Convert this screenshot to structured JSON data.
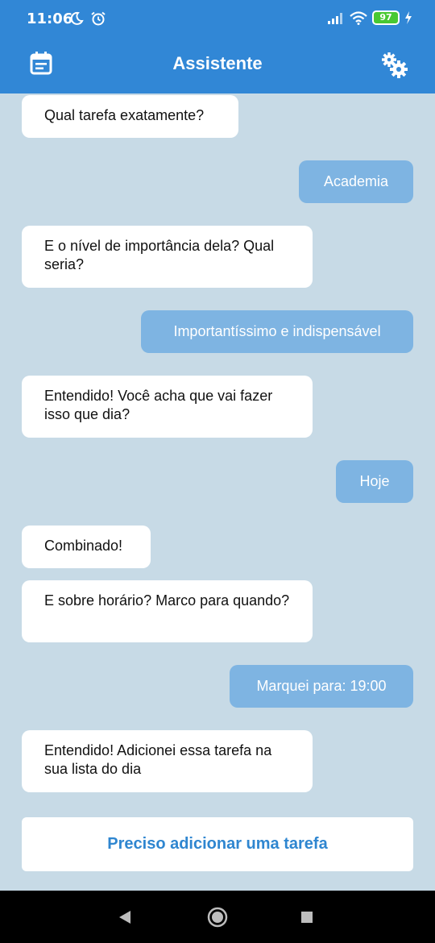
{
  "status_bar": {
    "time": "11:06",
    "battery": "97",
    "icons": [
      "moon-icon",
      "alarm-icon",
      "signal-icon",
      "wifi-icon",
      "battery-icon",
      "charging-icon"
    ]
  },
  "header": {
    "title": "Assistente",
    "left_icon": "calendar-icon",
    "right_icon": "settings-gears-icon"
  },
  "messages": [
    {
      "from": "bot",
      "text": "Qual tarefa exatamente?"
    },
    {
      "from": "user",
      "text": "Academia"
    },
    {
      "from": "bot",
      "text": "E o nível de importância dela? Qual seria?"
    },
    {
      "from": "user",
      "text": "Importantíssimo e indispensável"
    },
    {
      "from": "bot",
      "text": "Entendido! Você acha que vai fazer isso que dia?"
    },
    {
      "from": "user",
      "text": "Hoje"
    },
    {
      "from": "bot",
      "text": "Combinado!"
    },
    {
      "from": "bot",
      "text": "E sobre horário? Marco para quando?"
    },
    {
      "from": "user",
      "text": "Marquei para: 19:00"
    },
    {
      "from": "bot",
      "text": "Entendido! Adicionei essa tarefa na sua lista do dia"
    }
  ],
  "add_task_button": "Preciso adicionar uma tarefa",
  "colors": {
    "primary": "#3187d6",
    "background": "#c7dae6",
    "user_bubble": "#7eb4e2",
    "bot_bubble": "#ffffff",
    "button_text": "#2f86d0"
  },
  "nav": [
    "back-icon",
    "home-icon",
    "recent-apps-icon"
  ]
}
